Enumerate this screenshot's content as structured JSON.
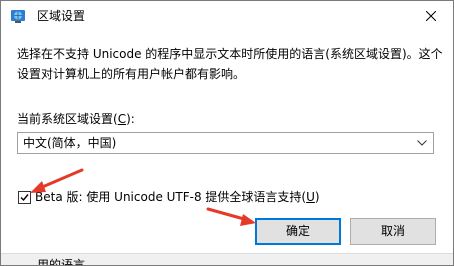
{
  "window": {
    "title": "区域设置",
    "close_icon": "close-icon"
  },
  "description": "选择在不支持 Unicode 的程序中显示文本时所使用的语言(系统区域设置)。这个设置对计算机上的所有用户帐户都有影响。",
  "locale": {
    "label_prefix": "当前系统区域设置(",
    "label_key": "C",
    "label_suffix": "):",
    "selected": "中文(简体，中国)"
  },
  "beta": {
    "checked": true,
    "label_prefix": "Beta 版: 使用 Unicode UTF-8 提供全球语言支持(",
    "label_key": "U",
    "label_suffix": ")"
  },
  "buttons": {
    "ok": "确定",
    "cancel": "取消"
  },
  "background_text": "用的语言。",
  "colors": {
    "annotation_arrow": "#e53a2a",
    "focus_border": "#0078d7",
    "button_bg": "#e1e1e1"
  }
}
